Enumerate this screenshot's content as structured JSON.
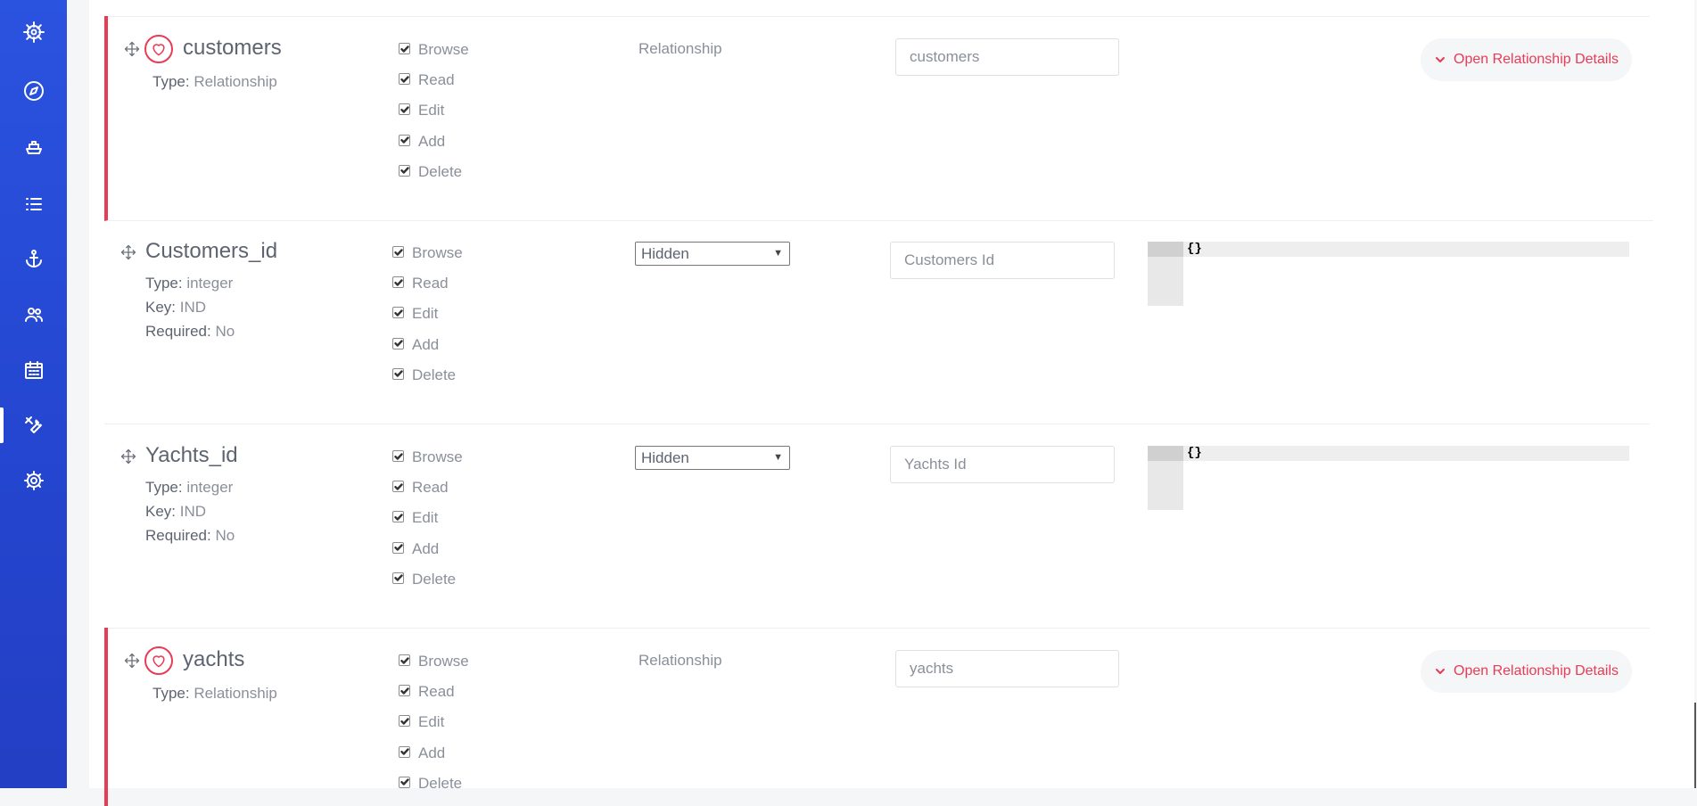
{
  "sidebar": {
    "items": [
      {
        "icon": "helm-icon",
        "active": false
      },
      {
        "icon": "compass-icon",
        "active": false
      },
      {
        "icon": "boat-icon",
        "active": false
      },
      {
        "icon": "list-icon",
        "active": false
      },
      {
        "icon": "anchor-icon",
        "active": false
      },
      {
        "icon": "people-icon",
        "active": false
      },
      {
        "icon": "calendar-icon",
        "active": false
      },
      {
        "icon": "tools-icon",
        "active": true
      },
      {
        "icon": "gear-icon",
        "active": false
      }
    ],
    "accent": "#2445cf"
  },
  "colors": {
    "relationship_accent": "#e93b55"
  },
  "fields": [
    {
      "name": "customers",
      "kind": "relationship",
      "type_label": "Type:",
      "type_value": "Relationship",
      "permissions": [
        "Browse",
        "Read",
        "Edit",
        "Add",
        "Delete"
      ],
      "input_type": "Relationship",
      "display_name": "customers",
      "details_button": "Open Relationship Details"
    },
    {
      "name": "Customers_id",
      "kind": "field",
      "type_label": "Type:",
      "type_value": "integer",
      "key_label": "Key:",
      "key_value": "IND",
      "required_label": "Required:",
      "required_value": "No",
      "permissions": [
        "Browse",
        "Read",
        "Edit",
        "Add",
        "Delete"
      ],
      "input_type": "Hidden",
      "display_name": "Customers Id",
      "details_json": "{}"
    },
    {
      "name": "Yachts_id",
      "kind": "field",
      "type_label": "Type:",
      "type_value": "integer",
      "key_label": "Key:",
      "key_value": "IND",
      "required_label": "Required:",
      "required_value": "No",
      "permissions": [
        "Browse",
        "Read",
        "Edit",
        "Add",
        "Delete"
      ],
      "input_type": "Hidden",
      "display_name": "Yachts Id",
      "details_json": "{}"
    },
    {
      "name": "yachts",
      "kind": "relationship",
      "type_label": "Type:",
      "type_value": "Relationship",
      "permissions": [
        "Browse",
        "Read",
        "Edit",
        "Add",
        "Delete"
      ],
      "input_type": "Relationship",
      "display_name": "yachts",
      "details_button": "Open Relationship Details"
    }
  ]
}
